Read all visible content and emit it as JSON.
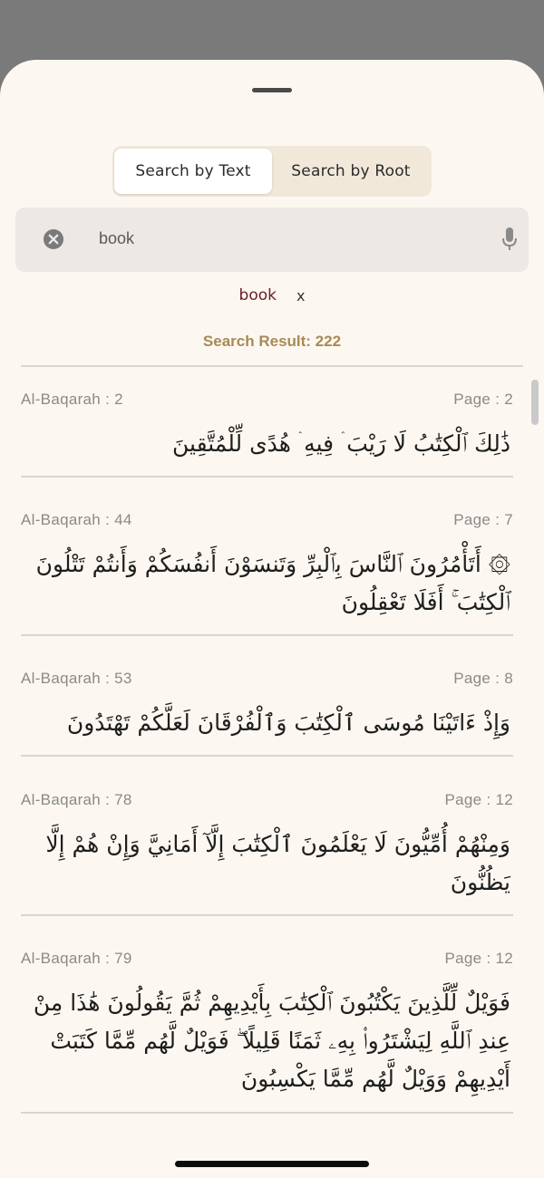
{
  "tabs": {
    "text_label": "Search by Text",
    "root_label": "Search by Root"
  },
  "search": {
    "value": "book",
    "clear_icon": "close-circle-icon",
    "mic_icon": "microphone-icon"
  },
  "filter_chip": {
    "word": "book",
    "remove_label": "x"
  },
  "results": {
    "label": "Search Result:  222"
  },
  "verses": [
    {
      "surah": "Al-Baqarah : 2",
      "page": "Page : 2",
      "text": "ذَٰلِكَ ٱلْكِتَٰبُ لَا رَيْبَ ۛ فِيهِ ۛ هُدًى لِّلْمُتَّقِينَ"
    },
    {
      "surah": "Al-Baqarah : 44",
      "page": "Page : 7",
      "text": "۞ أَتَأْمُرُونَ ٱلنَّاسَ بِٱلْبِرِّ وَتَنسَوْنَ أَنفُسَكُمْ وَأَنتُمْ تَتْلُونَ ٱلْكِتَٰبَ ۚ أَفَلَا تَعْقِلُونَ"
    },
    {
      "surah": "Al-Baqarah : 53",
      "page": "Page : 8",
      "text": "وَإِذْ ءَاتَيْنَا مُوسَى ٱلْكِتَٰبَ وَٱلْفُرْقَانَ لَعَلَّكُمْ تَهْتَدُونَ"
    },
    {
      "surah": "Al-Baqarah : 78",
      "page": "Page : 12",
      "text": "وَمِنْهُمْ أُمِّيُّونَ لَا يَعْلَمُونَ ٱلْكِتَٰبَ إِلَّآ أَمَانِيَّ وَإِنْ هُمْ إِلَّا يَظُنُّونَ"
    },
    {
      "surah": "Al-Baqarah : 79",
      "page": "Page : 12",
      "text": "فَوَيْلٌ لِّلَّذِينَ يَكْتُبُونَ ٱلْكِتَٰبَ بِأَيْدِيهِمْ ثُمَّ يَقُولُونَ هَٰذَا مِنْ عِندِ ٱللَّهِ لِيَشْتَرُوا۟ بِهِۦ ثَمَنًا قَلِيلًا ۖ فَوَيْلٌ لَّهُم مِّمَّا كَتَبَتْ أَيْدِيهِمْ وَوَيْلٌ لَّهُم مِّمَّا يَكْسِبُونَ"
    }
  ],
  "colors": {
    "sheet_background": "#fcf8f1",
    "accent_gold": "#a88a55",
    "chip_word": "#6b1a2a",
    "segment_background": "#f1e8da"
  }
}
